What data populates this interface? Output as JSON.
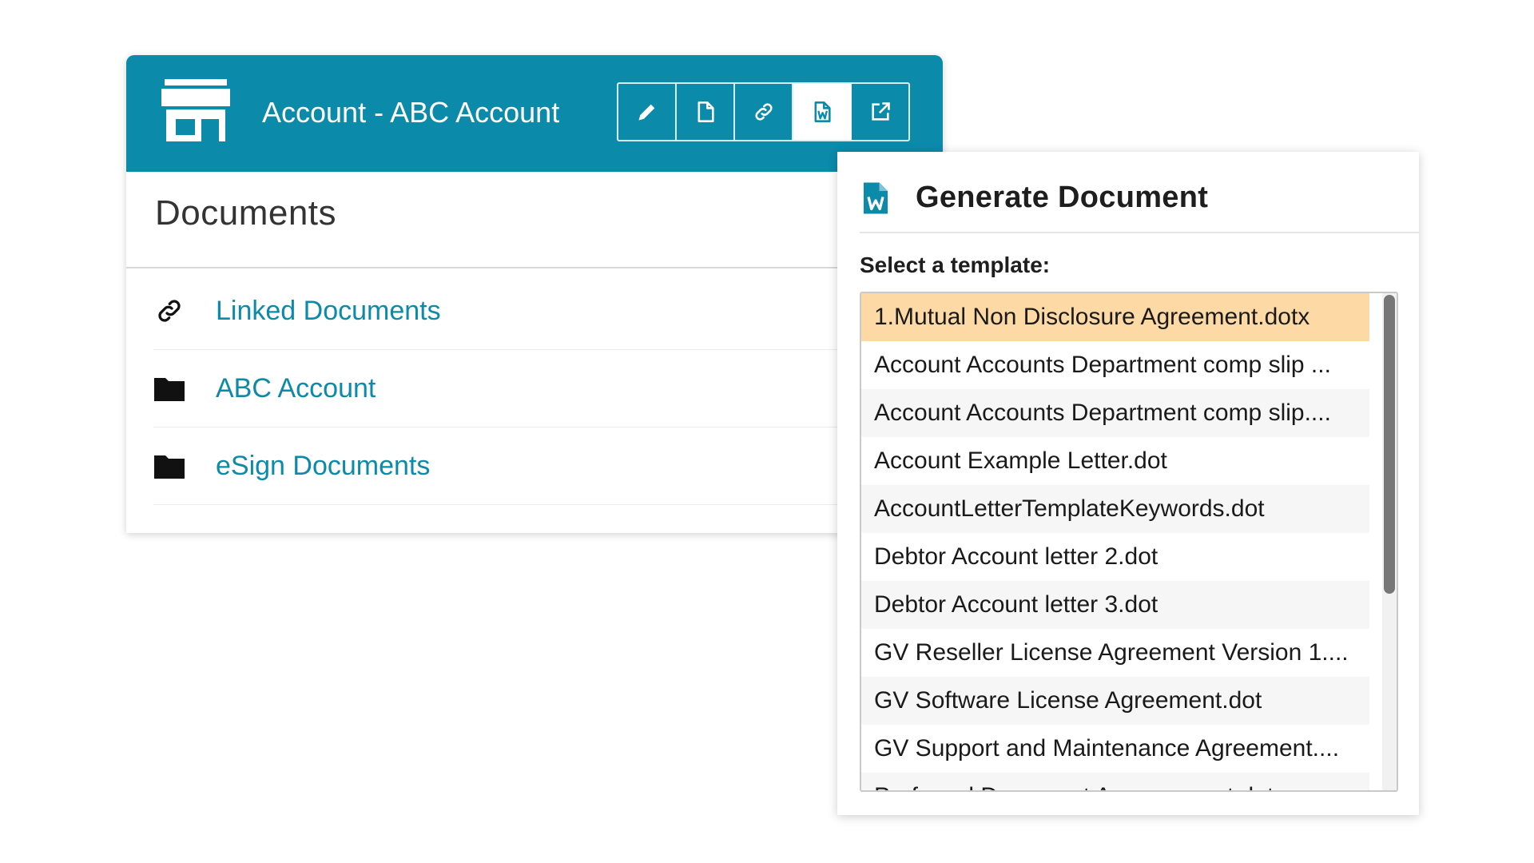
{
  "header": {
    "title": "Account - ABC Account",
    "icon": "store-icon",
    "accent_color": "#0b8aaa",
    "toolbar": [
      {
        "icon": "pencil-icon",
        "name": "edit-button"
      },
      {
        "icon": "document-icon",
        "name": "new-document-button"
      },
      {
        "icon": "link-icon",
        "name": "link-button"
      },
      {
        "icon": "word-document-icon",
        "name": "generate-document-button",
        "active": true
      },
      {
        "icon": "external-link-icon",
        "name": "open-external-button"
      }
    ]
  },
  "documents": {
    "title": "Documents",
    "items": [
      {
        "label": "Linked Documents",
        "icon": "link-icon"
      },
      {
        "label": "ABC Account",
        "icon": "folder-icon"
      },
      {
        "label": "eSign Documents",
        "icon": "folder-icon"
      }
    ]
  },
  "generate": {
    "title": "Generate Document",
    "icon": "word-document-icon",
    "select_label": "Select a template:",
    "templates": [
      "1.Mutual Non Disclosure Agreement.dotx",
      "Account Accounts Department comp slip ...",
      "Account Accounts Department comp slip....",
      "Account Example Letter.dot",
      "AccountLetterTemplateKeywords.dot",
      "Debtor Account letter 2.dot",
      "Debtor Account letter 3.dot",
      "GV Reseller License Agreement Version 1....",
      "GV Software License Agreement.dot",
      "GV Support and Maintenance Agreement....",
      "Preferred Document Arrangement.dot"
    ],
    "selected_index": 0,
    "selected_color": "#fdd9a6"
  }
}
